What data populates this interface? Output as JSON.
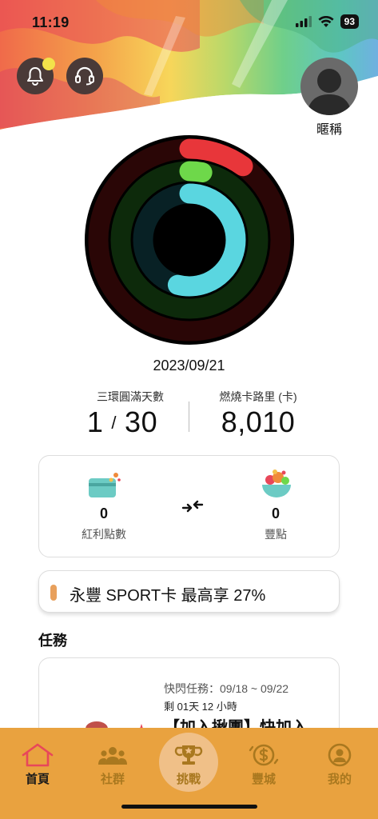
{
  "status_bar": {
    "time": "11:19",
    "battery": "93"
  },
  "profile": {
    "nickname": "暱稱"
  },
  "activity": {
    "date": "2023/09/21",
    "rings": [
      {
        "name": "outer",
        "color": "#e8363a",
        "track": "#2a0606",
        "progress": 0.1
      },
      {
        "name": "middle",
        "color": "#6ed84a",
        "track": "#0d2a0b",
        "progress": 0.03
      },
      {
        "name": "inner",
        "color": "#5ad6e0",
        "track": "#082125",
        "progress": 0.54
      }
    ]
  },
  "stats": {
    "rings_label": "三環圓滿天數",
    "rings_done": "1",
    "slash": "/",
    "rings_total": "30",
    "calories_label": "燃燒卡路里 (卡)",
    "calories_value": "8,010"
  },
  "points": {
    "bonus_value": "0",
    "bonus_label": "紅利點數",
    "feng_value": "0",
    "feng_label": "豐點"
  },
  "promo": {
    "text": "永豐 SPORT卡 最高享 27%"
  },
  "tasks": {
    "section_title": "任務",
    "flash_time": "快閃任務：09/18 ~ 09/22",
    "remaining": "剩 01天 12 小時",
    "title": "【加入揪團】快加入"
  },
  "tabs": [
    {
      "label": "首頁",
      "icon": "home-icon",
      "active": true
    },
    {
      "label": "社群",
      "icon": "community-icon",
      "active": false
    },
    {
      "label": "挑戰",
      "icon": "trophy-icon",
      "active": false
    },
    {
      "label": "豐城",
      "icon": "coin-city-icon",
      "active": false
    },
    {
      "label": "我的",
      "icon": "user-icon",
      "active": false
    }
  ],
  "colors": {
    "tab_bar": "#e9a23f",
    "accent": "#e8a05c"
  }
}
